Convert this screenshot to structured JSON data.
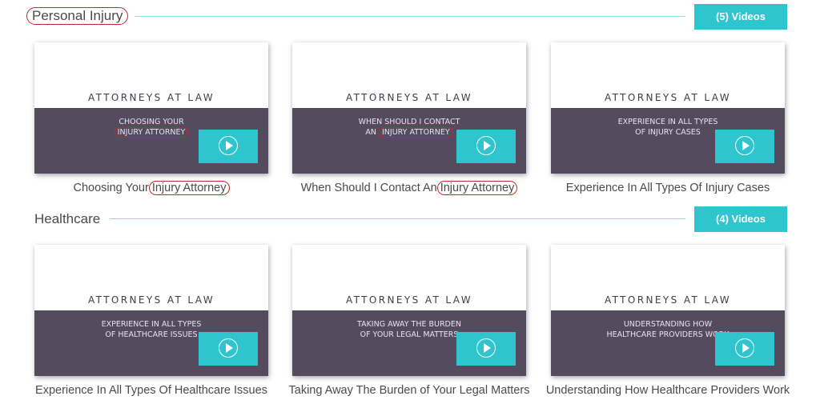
{
  "sections": [
    {
      "title": "Personal Injury",
      "videos_label": "(5) Videos",
      "cards": [
        {
          "brand": "ATTORNEYS AT LAW",
          "band_line1": "CHOOSING YOUR",
          "band_line2": "INJURY ATTORNEY",
          "caption_pre": "Choosing Your",
          "caption_hl": "Injury Attorney"
        },
        {
          "brand": "ATTORNEYS AT LAW",
          "band_line1": "WHEN SHOULD I CONTACT",
          "band_line2_pre": "AN",
          "band_line2": "INJURY ATTORNEY",
          "caption_pre": "When Should I Contact An",
          "caption_hl": "Injury Attorney"
        },
        {
          "brand": "ATTORNEYS AT LAW",
          "band_line1": "EXPERIENCE IN ALL TYPES",
          "band_line2": "OF INJURY CASES",
          "caption": "Experience In All Types Of Injury Cases"
        }
      ]
    },
    {
      "title": "Healthcare",
      "videos_label": "(4) Videos",
      "cards": [
        {
          "brand": "ATTORNEYS AT LAW",
          "band_line1": "EXPERIENCE IN ALL TYPES",
          "band_line2": "OF HEALTHCARE ISSUES",
          "caption": "Experience In All Types Of Healthcare Issues"
        },
        {
          "brand": "ATTORNEYS AT LAW",
          "band_line1": "TAKING AWAY THE BURDEN",
          "band_line2": "OF YOUR LEGAL MATTERS",
          "caption": "Taking Away The Burden of Your Legal Matters"
        },
        {
          "brand": "ATTORNEYS AT LAW",
          "band_line1": "UNDERSTANDING HOW",
          "band_line2": "HEALTHCARE PROVIDERS WORK",
          "caption": "Understanding How Healthcare Providers Work"
        }
      ]
    }
  ],
  "colors": {
    "accent": "#2ec5cf",
    "band": "#544c5e",
    "annotation": "#c0282d"
  }
}
